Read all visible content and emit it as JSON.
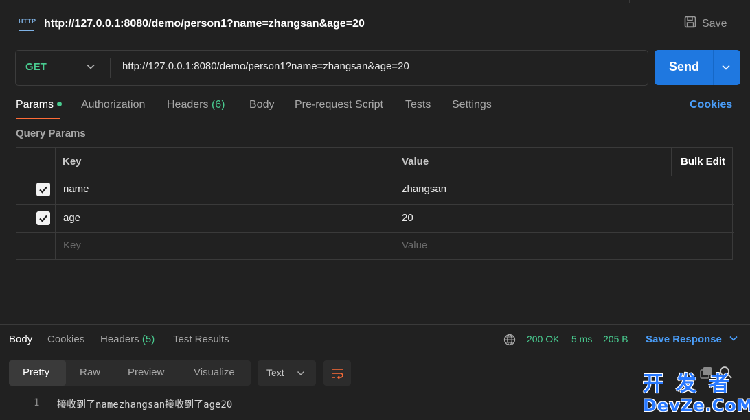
{
  "header": {
    "http_badge": "HTTP",
    "title": "http://127.0.0.1:8080/demo/person1?name=zhangsan&age=20",
    "save_label": "Save"
  },
  "request": {
    "method": "GET",
    "url": "http://127.0.0.1:8080/demo/person1?name=zhangsan&age=20",
    "send_label": "Send"
  },
  "tabs": {
    "params": "Params",
    "authorization": "Authorization",
    "headers": "Headers",
    "headers_count": "(6)",
    "body": "Body",
    "pre_request": "Pre-request Script",
    "tests": "Tests",
    "settings": "Settings",
    "cookies": "Cookies"
  },
  "query_params": {
    "title": "Query Params",
    "col_key": "Key",
    "col_value": "Value",
    "bulk_edit": "Bulk Edit",
    "rows": [
      {
        "key": "name",
        "value": "zhangsan",
        "checked": true
      },
      {
        "key": "age",
        "value": "20",
        "checked": true
      }
    ],
    "placeholder_key": "Key",
    "placeholder_value": "Value"
  },
  "response": {
    "tabs": {
      "body": "Body",
      "cookies": "Cookies",
      "headers": "Headers",
      "headers_count": "(5)",
      "test_results": "Test Results"
    },
    "status": "200 OK",
    "time": "5 ms",
    "size": "205 B",
    "save_response": "Save Response",
    "views": [
      "Pretty",
      "Raw",
      "Preview",
      "Visualize"
    ],
    "format": "Text",
    "line_number": "1",
    "body_text": "接收到了namezhangsan接收到了age20"
  },
  "watermark": {
    "cn": "开发者",
    "en": "DevZe.CoM"
  },
  "colors": {
    "accent_green": "#49cc90",
    "accent_blue": "#1f78e0",
    "accent_orange": "#ff6c37",
    "link_blue": "#4a9df8"
  }
}
